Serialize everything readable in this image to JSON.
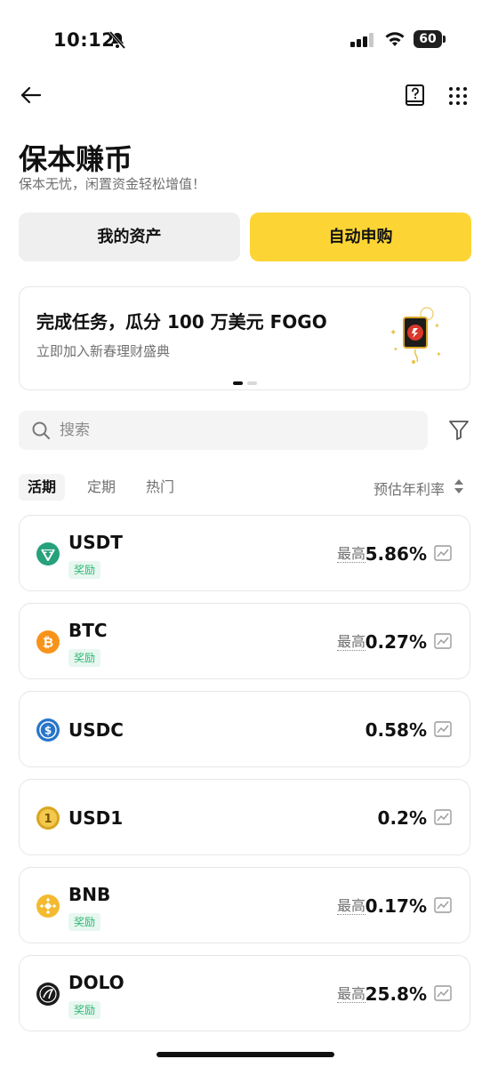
{
  "status_bar": {
    "time": "10:12",
    "battery": "60"
  },
  "header": {
    "title": "保本赚币",
    "subtitle": "保本无忧，闲置资金轻松增值！"
  },
  "actions": {
    "my_assets": "我的资产",
    "auto_subscribe": "自动申购"
  },
  "banner": {
    "title": "完成任务，瓜分 100 万美元 FOGO",
    "subtitle": "立即加入新春理财盛典"
  },
  "search": {
    "placeholder": "搜索"
  },
  "tabs": [
    {
      "label": "活期",
      "active": true
    },
    {
      "label": "定期",
      "active": false
    },
    {
      "label": "热门",
      "active": false
    }
  ],
  "sort_label": "预估年利率",
  "products": [
    {
      "name": "USDT",
      "reward": "奖励",
      "max_label": "最高",
      "rate": "5.86%",
      "icon": "usdt-icon",
      "color": "#26a17b"
    },
    {
      "name": "BTC",
      "reward": "奖励",
      "max_label": "最高",
      "rate": "0.27%",
      "icon": "btc-icon",
      "color": "#f7931a"
    },
    {
      "name": "USDC",
      "rate": "0.58%",
      "icon": "usdc-icon",
      "color": "#2775ca"
    },
    {
      "name": "USD1",
      "rate": "0.2%",
      "icon": "usd1-icon",
      "color": "#d9a520"
    },
    {
      "name": "BNB",
      "reward": "奖励",
      "max_label": "最高",
      "rate": "0.17%",
      "icon": "bnb-icon",
      "color": "#f3ba2f"
    },
    {
      "name": "DOLO",
      "reward": "奖励",
      "max_label": "最高",
      "rate": "25.8%",
      "icon": "dolo-icon",
      "color": "#1a1a1a"
    }
  ],
  "colors": {
    "accent": "#fcd535",
    "reward_green": "#2eb872"
  }
}
